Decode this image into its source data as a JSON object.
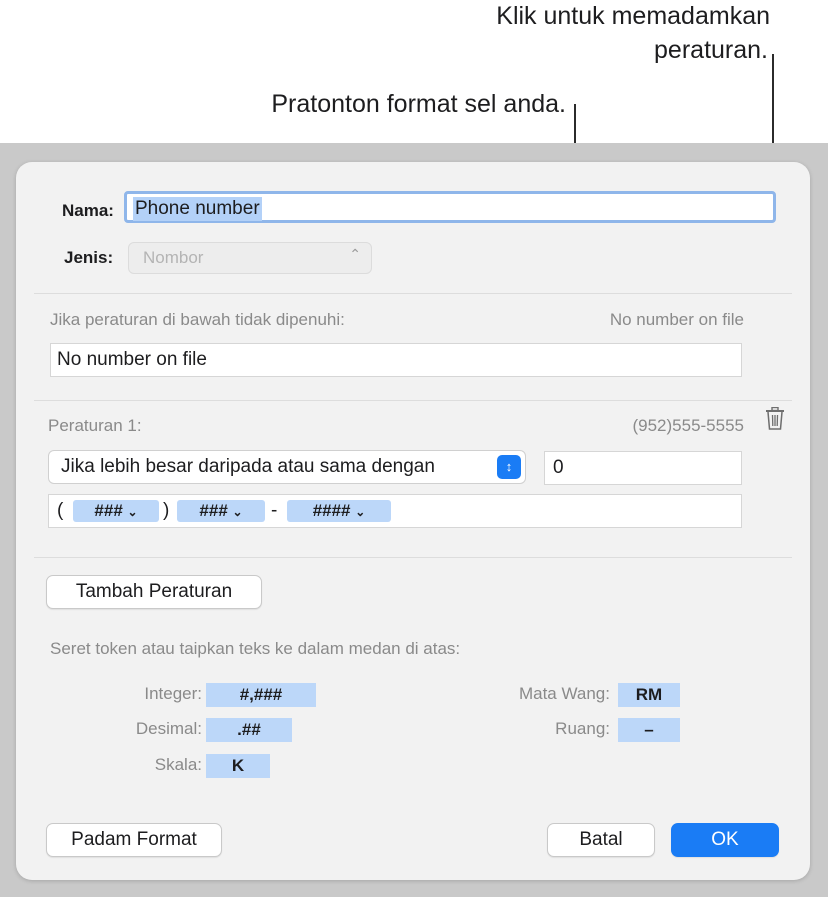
{
  "callouts": {
    "delete_rule_line1": "Klik untuk memadamkan",
    "delete_rule_line2": "peraturan.",
    "preview": "Pratonton format sel anda."
  },
  "dialog": {
    "name_label": "Nama:",
    "name_value": "Phone number",
    "type_label": "Jenis:",
    "type_value": "Nombor",
    "fallback_label": "Jika peraturan di bawah tidak dipenuhi:",
    "fallback_preview": "No number on file",
    "fallback_value": "No number on file",
    "rule_label": "Peraturan 1:",
    "rule_preview": "(952)555-5555",
    "rule_condition": "Jika lebih besar daripada atau sama dengan",
    "rule_value": "0",
    "format": {
      "open_paren": "(",
      "token1": "###",
      "close_paren": ")",
      "token2": "###",
      "dash": "-",
      "token3": "####"
    },
    "add_rule_button": "Tambah Peraturan",
    "hint": "Seret token atau taipkan teks ke dalam medan di atas:",
    "tokens": {
      "integer_label": "Integer:",
      "integer_token": "#,###",
      "decimal_label": "Desimal:",
      "decimal_token": ".##",
      "scale_label": "Skala:",
      "scale_token": "K",
      "currency_label": "Mata Wang:",
      "currency_token": "RM",
      "space_label": "Ruang:",
      "space_token": "–"
    },
    "delete_format_button": "Padam Format",
    "cancel_button": "Batal",
    "ok_button": "OK"
  },
  "colors": {
    "accent": "#1a7cf5",
    "token_bg": "#bcd7f9"
  }
}
